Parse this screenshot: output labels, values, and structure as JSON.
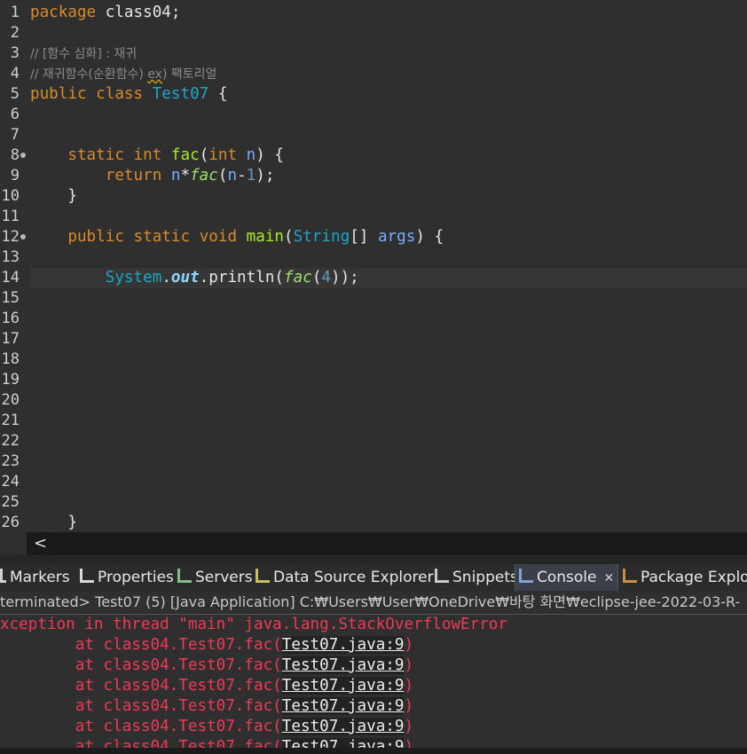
{
  "editor": {
    "lines": [
      {
        "n": "1",
        "tokens": [
          [
            "kw",
            "package"
          ],
          [
            "plain",
            " class04;"
          ]
        ]
      },
      {
        "n": "2",
        "tokens": []
      },
      {
        "n": "3",
        "tokens": [
          [
            "comment",
            "// [함수 심화] : 재귀"
          ]
        ]
      },
      {
        "n": "4",
        "tokens": [
          [
            "comment",
            "// 재귀함수(순환함수) "
          ],
          [
            "comment-sq",
            "ex"
          ],
          [
            "comment",
            ") 팩토리얼"
          ]
        ]
      },
      {
        "n": "5",
        "tokens": [
          [
            "kw",
            "public"
          ],
          [
            "plain",
            " "
          ],
          [
            "kw",
            "class"
          ],
          [
            "plain",
            " "
          ],
          [
            "cls",
            "Test07"
          ],
          [
            "plain",
            " {"
          ]
        ]
      },
      {
        "n": "6",
        "tokens": []
      },
      {
        "n": "7",
        "tokens": []
      },
      {
        "n": "8",
        "fold": true,
        "tokens": [
          [
            "plain",
            "    "
          ],
          [
            "kw",
            "static"
          ],
          [
            "plain",
            " "
          ],
          [
            "kw",
            "int"
          ],
          [
            "plain",
            " "
          ],
          [
            "fn",
            "fac"
          ],
          [
            "plain",
            "("
          ],
          [
            "kw",
            "int"
          ],
          [
            "plain",
            " "
          ],
          [
            "var",
            "n"
          ],
          [
            "plain",
            ") {"
          ]
        ]
      },
      {
        "n": "9",
        "tokens": [
          [
            "plain",
            "        "
          ],
          [
            "kw",
            "return"
          ],
          [
            "plain",
            " "
          ],
          [
            "var",
            "n"
          ],
          [
            "plain",
            "*"
          ],
          [
            "fncall",
            "fac"
          ],
          [
            "plain",
            "("
          ],
          [
            "var",
            "n"
          ],
          [
            "plain",
            "-"
          ],
          [
            "num",
            "1"
          ],
          [
            "plain",
            ");"
          ]
        ]
      },
      {
        "n": "10",
        "tokens": [
          [
            "plain",
            "    }"
          ]
        ]
      },
      {
        "n": "11",
        "tokens": []
      },
      {
        "n": "12",
        "fold": true,
        "tokens": [
          [
            "plain",
            "    "
          ],
          [
            "kw",
            "public"
          ],
          [
            "plain",
            " "
          ],
          [
            "kw",
            "static"
          ],
          [
            "plain",
            " "
          ],
          [
            "kw",
            "void"
          ],
          [
            "plain",
            " "
          ],
          [
            "fn",
            "main"
          ],
          [
            "plain",
            "("
          ],
          [
            "cls",
            "String"
          ],
          [
            "plain",
            "[] "
          ],
          [
            "var",
            "args"
          ],
          [
            "plain",
            ") {"
          ]
        ]
      },
      {
        "n": "13",
        "tokens": []
      },
      {
        "n": "14",
        "current": true,
        "tokens": [
          [
            "plain",
            "        "
          ],
          [
            "cls",
            "System"
          ],
          [
            "plain",
            "."
          ],
          [
            "out",
            "out"
          ],
          [
            "plain",
            ".println("
          ],
          [
            "fncall",
            "fac"
          ],
          [
            "plain",
            "("
          ],
          [
            "num",
            "4"
          ],
          [
            "plain",
            "));"
          ]
        ]
      },
      {
        "n": "15",
        "tokens": []
      },
      {
        "n": "16",
        "tokens": []
      },
      {
        "n": "17",
        "tokens": []
      },
      {
        "n": "18",
        "tokens": []
      },
      {
        "n": "19",
        "tokens": []
      },
      {
        "n": "20",
        "tokens": []
      },
      {
        "n": "21",
        "tokens": []
      },
      {
        "n": "22",
        "tokens": []
      },
      {
        "n": "23",
        "tokens": []
      },
      {
        "n": "24",
        "tokens": []
      },
      {
        "n": "25",
        "tokens": []
      },
      {
        "n": "26",
        "tokens": [
          [
            "plain",
            "    }"
          ]
        ]
      }
    ]
  },
  "scroll_arrow": "<",
  "tabs": [
    {
      "label": "Markers",
      "icon": "markers-icon"
    },
    {
      "label": "Properties",
      "icon": "properties-icon"
    },
    {
      "label": "Servers",
      "icon": "servers-icon"
    },
    {
      "label": "Data Source Explorer",
      "icon": "data-source-icon"
    },
    {
      "label": "Snippets",
      "icon": "snippets-icon"
    },
    {
      "label": "Console",
      "icon": "console-icon",
      "active": true
    },
    {
      "label": "Package Explore",
      "icon": "package-explorer-icon"
    }
  ],
  "close_glyph": "✕",
  "console_header": "terminated> Test07 (5) [Java Application] C:₩Users₩User₩OneDrive₩바탕 화면₩eclipse-jee-2022-03-R-",
  "console": {
    "exception": "xception in thread \"main\" java.lang.StackOverflowError",
    "frame_prefix": "        at class04.Test07.fac(",
    "frame_link": "Test07.java:9",
    "frame_suffix": ")",
    "frame_count": 6
  },
  "colors": {
    "editor_bg": "#2f2f2f",
    "keyword": "#d98a2a",
    "type": "#1ea5c8",
    "method": "#a7ec21",
    "error": "#ee3a55"
  }
}
